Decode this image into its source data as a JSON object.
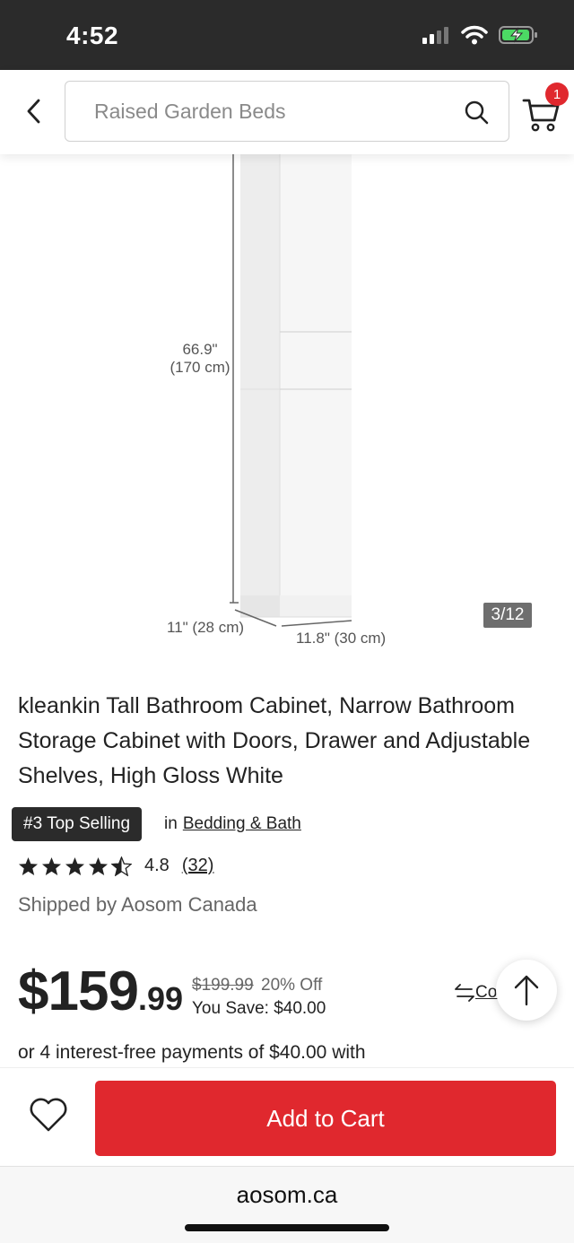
{
  "status_bar": {
    "time": "4:52"
  },
  "header": {
    "search_placeholder": "Raised Garden Beds",
    "cart_count": "1"
  },
  "gallery": {
    "counter": "3/12",
    "dimensions": {
      "height_in": "66.9\"",
      "height_cm": "(170 cm)",
      "depth": "11\" (28 cm)",
      "width": "11.8\" (30 cm)"
    }
  },
  "product": {
    "title": "kleankin Tall Bathroom Cabinet, Narrow Bathroom Storage Cabinet with Doors, Drawer and Adjustable Shelves, High Gloss White",
    "rank_badge": "#3 Top Selling",
    "rank_in": "in",
    "rank_category": "Bedding & Bath",
    "rating": 4.5,
    "rating_value": "4.8",
    "review_count": "(32)",
    "shipped_by": "Shipped by Aosom Canada"
  },
  "price": {
    "dollars": "$159",
    "cents": ".99",
    "original": "$199.99",
    "discount": "20% Off",
    "savings": "You Save: $40.00",
    "compare_label": "Compare",
    "installments": "or 4 interest-free payments of $40.00 with"
  },
  "actions": {
    "add_to_cart": "Add to Cart"
  },
  "browser": {
    "url": "aosom.ca"
  },
  "colors": {
    "accent": "#e0282e",
    "dark": "#2b2b2b"
  }
}
